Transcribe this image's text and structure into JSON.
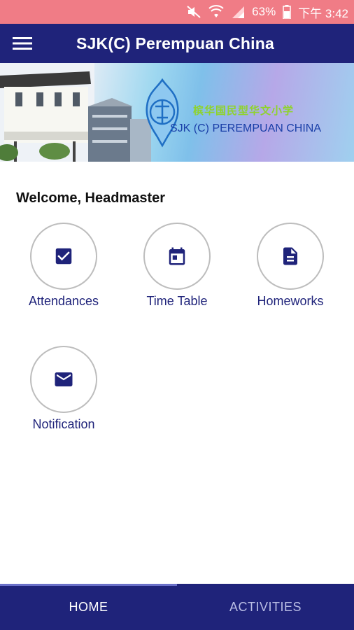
{
  "status_bar": {
    "battery_percent": "63%",
    "time": "下午 3:42",
    "icons": [
      "mute-icon",
      "wifi-icon",
      "signal-icon",
      "battery-icon"
    ]
  },
  "app_bar": {
    "title": "SJK(C) Perempuan China",
    "menu_icon": "hamburger-menu-icon",
    "color": "#1f237a"
  },
  "banner": {
    "chinese_name": "槟华国民型华文小学",
    "english_name": "SJK (C) PEREMPUAN CHINA"
  },
  "main": {
    "welcome": "Welcome, Headmaster",
    "tiles": [
      {
        "label": "Attendances",
        "icon": "checkbox-icon"
      },
      {
        "label": "Time Table",
        "icon": "calendar-icon"
      },
      {
        "label": "Homeworks",
        "icon": "document-icon"
      },
      {
        "label": "Notification",
        "icon": "mail-icon"
      }
    ]
  },
  "bottom_nav": {
    "tabs": [
      {
        "label": "HOME",
        "active": true
      },
      {
        "label": "ACTIVITIES",
        "active": false
      }
    ]
  },
  "colors": {
    "status_bar": "#f07c86",
    "primary": "#1f237a",
    "circle_border": "#bdbdbd"
  }
}
